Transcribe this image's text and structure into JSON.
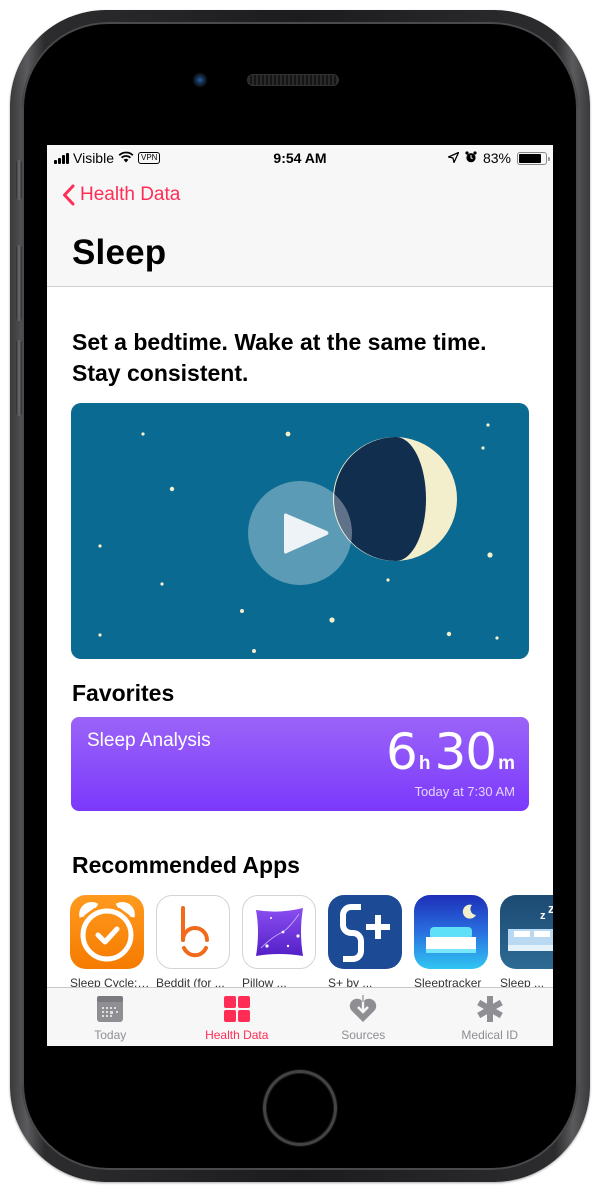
{
  "status_bar": {
    "carrier": "Visible",
    "vpn_label": "VPN",
    "time": "9:54 AM",
    "battery_percent": "83%",
    "battery_level": 0.83,
    "icons": [
      "signal-icon",
      "wifi-icon",
      "vpn-icon",
      "location-icon",
      "alarm-icon",
      "battery-icon"
    ]
  },
  "nav": {
    "back_label": "Health Data",
    "title": "Sleep"
  },
  "headline": "Set a bedtime. Wake at the same time. Stay consistent.",
  "video": {
    "play_icon": "play-icon",
    "illustration": "crescent-moon-night-sky"
  },
  "favorites": {
    "title": "Favorites",
    "card": {
      "title": "Sleep Analysis",
      "hours": "6",
      "hours_unit": "h",
      "minutes": "30",
      "minutes_unit": "m",
      "date": "Today at 7:30 AM"
    }
  },
  "recommended": {
    "title": "Recommended Apps",
    "apps": [
      {
        "label": "Sleep Cycle: ...",
        "icon": "alarm-clock-icon"
      },
      {
        "label": "Beddit (for ...",
        "icon": "beddit-b-icon"
      },
      {
        "label": "Pillow ...",
        "icon": "pillow-icon"
      },
      {
        "label": "S+ by ...",
        "icon": "s-plus-icon"
      },
      {
        "label": "Sleeptracker",
        "icon": "bed-moon-icon"
      },
      {
        "label": "Sleep ...",
        "icon": "bed-zzz-icon"
      }
    ]
  },
  "tab_bar": {
    "tabs": [
      {
        "label": "Today",
        "icon": "calendar-icon",
        "active": false
      },
      {
        "label": "Health Data",
        "icon": "grid-icon",
        "active": true
      },
      {
        "label": "Sources",
        "icon": "heart-arrow-icon",
        "active": false
      },
      {
        "label": "Medical ID",
        "icon": "asterisk-icon",
        "active": false
      }
    ]
  },
  "colors": {
    "accent": "#ff2d55",
    "video_bg": "#0b6a91",
    "moon_dark": "#112e4f",
    "moon_light": "#f3eecb",
    "sleep_card_top": "#9b63f8",
    "sleep_card_bottom": "#7b38fc",
    "tab_inactive": "#8e8e93"
  }
}
